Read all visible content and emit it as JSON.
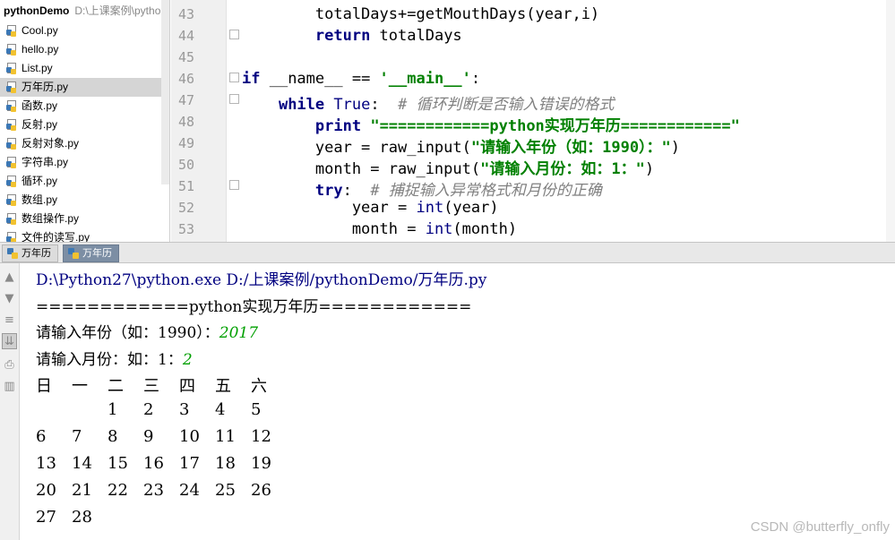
{
  "project": {
    "name": "pythonDemo",
    "path": "D:\\上课案例\\pythonDemo",
    "files": [
      {
        "name": "Cool.py",
        "selected": false
      },
      {
        "name": "hello.py",
        "selected": false
      },
      {
        "name": "List.py",
        "selected": false
      },
      {
        "name": "万年历.py",
        "selected": true
      },
      {
        "name": "函数.py",
        "selected": false
      },
      {
        "name": "反射.py",
        "selected": false
      },
      {
        "name": "反射对象.py",
        "selected": false
      },
      {
        "name": "字符串.py",
        "selected": false
      },
      {
        "name": "循环.py",
        "selected": false
      },
      {
        "name": "数组.py",
        "selected": false
      },
      {
        "name": "数组操作.py",
        "selected": false
      },
      {
        "name": "文件的读写.py",
        "selected": false
      }
    ]
  },
  "editor": {
    "line_numbers": [
      "43",
      "44",
      "45",
      "46",
      "47",
      "48",
      "49",
      "50",
      "51",
      "52",
      "53"
    ]
  },
  "run": {
    "tabs": [
      "万年历",
      "万年历"
    ],
    "toolbar_icons": [
      "arrow-up-icon",
      "arrow-down-icon",
      "soft-wrap-icon",
      "scroll-to-end-icon",
      "print-icon",
      "trash-icon"
    ],
    "console": {
      "command": "D:\\Python27\\python.exe D:/上课案例/pythonDemo/万年历.py",
      "banner": "============python实现万年历============",
      "year_prompt": "请输入年份（如：1990）：",
      "year_input": "2017",
      "month_prompt": "请输入月份：如：1：",
      "month_input": "2",
      "weekdays": [
        "日",
        "一",
        "二",
        "三",
        "四",
        "五",
        "六"
      ],
      "weeks": [
        [
          "",
          "",
          "1",
          "2",
          "3",
          "4",
          "5"
        ],
        [
          "6",
          "7",
          "8",
          "9",
          "10",
          "11",
          "12"
        ],
        [
          "13",
          "14",
          "15",
          "16",
          "17",
          "18",
          "19"
        ],
        [
          "20",
          "21",
          "22",
          "23",
          "24",
          "25",
          "26"
        ],
        [
          "27",
          "28",
          "",
          "",
          "",
          "",
          ""
        ]
      ]
    }
  },
  "watermark": "CSDN @butterfly_onfly",
  "colors": {
    "keyword": "#000080",
    "string": "#008000",
    "comment": "#808080",
    "console_input": "#00a000",
    "selected_file_bg": "#d5d5d5"
  }
}
